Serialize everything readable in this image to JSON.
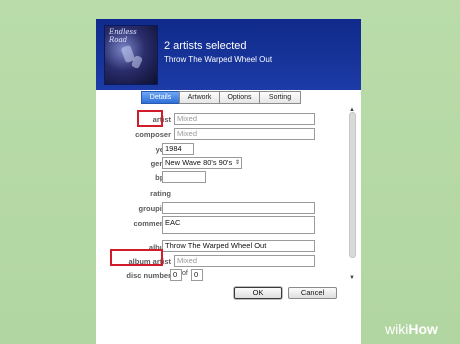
{
  "header": {
    "title": "2 artists selected",
    "subtitle": "Throw The Warped Wheel Out",
    "art_text": "Endless Road"
  },
  "tabs": [
    {
      "label": "Details",
      "active": true
    },
    {
      "label": "Artwork",
      "active": false
    },
    {
      "label": "Options",
      "active": false
    },
    {
      "label": "Sorting",
      "active": false
    }
  ],
  "fields": {
    "artist": {
      "label": "artist",
      "value": "Mixed"
    },
    "composer": {
      "label": "composer",
      "value": "Mixed"
    },
    "year": {
      "label": "year",
      "value": "1984"
    },
    "genre": {
      "label": "genre",
      "value": "New Wave 80's 90's"
    },
    "bpm": {
      "label": "bpm",
      "value": ""
    },
    "rating": {
      "label": "rating"
    },
    "grouping": {
      "label": "grouping",
      "value": ""
    },
    "comments": {
      "label": "comments",
      "value": "EAC"
    },
    "album": {
      "label": "album",
      "value": "Throw The Warped Wheel Out"
    },
    "album_artist": {
      "label": "album artist",
      "value": "Mixed"
    },
    "disc_number": {
      "label": "disc number",
      "value_a": "0",
      "of": "of",
      "value_b": "0"
    }
  },
  "buttons": {
    "ok": "OK",
    "cancel": "Cancel"
  },
  "watermark": {
    "wiki": "wiki",
    "how": "How"
  },
  "colors": {
    "header": "#1a35a0",
    "highlight": "#d11c2b",
    "background": "#b5d9a5"
  }
}
